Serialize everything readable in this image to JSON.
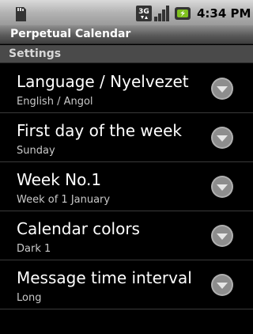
{
  "status_bar": {
    "time": "4:34 PM",
    "network_label": "3G",
    "icons": [
      "sd-card-icon",
      "3g-icon",
      "signal-icon",
      "battery-icon"
    ]
  },
  "app": {
    "title": "Perpetual Calendar"
  },
  "section": {
    "title": "Settings"
  },
  "settings": [
    {
      "title": "Language / Nyelvezet",
      "value": "English / Angol"
    },
    {
      "title": "First day of the week",
      "value": "Sunday"
    },
    {
      "title": "Week No.1",
      "value": "Week of 1 January"
    },
    {
      "title": "Calendar colors",
      "value": "Dark 1"
    },
    {
      "title": "Message time interval",
      "value": "Long"
    }
  ],
  "colors": {
    "background": "#000000",
    "section_header": "#4a4a4a",
    "dropdown_button": "#9a9a9a"
  }
}
